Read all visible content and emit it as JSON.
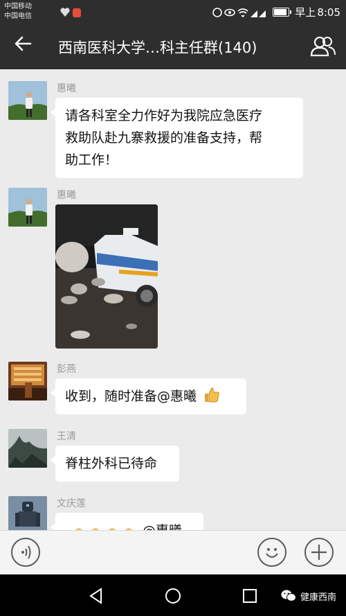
{
  "status_bar": {
    "carrier_1": "中国移动",
    "carrier_2": "中国电信",
    "network_1": "4G",
    "network_2": "3G/2G",
    "battery_level": 0.9,
    "period": "早上",
    "time": "8:05"
  },
  "header": {
    "title": "西南医科大学…科主任群(140)",
    "back_icon": "arrow-left-icon",
    "members_icon": "people-icon"
  },
  "messages": [
    {
      "sender": "惠曦",
      "type": "text",
      "lines": [
        "请各科室全力作好为我院应急医疗",
        "救助队赴九寨救援的准备支持，帮",
        "助工作！"
      ]
    },
    {
      "sender": "惠曦",
      "type": "image",
      "image_desc_icon": "photo-icon"
    },
    {
      "sender": "彭燕",
      "type": "text",
      "text": "收到，随时准备@惠曦",
      "emoji": "thumbs-up-icon"
    },
    {
      "sender": "王清",
      "type": "text",
      "text": "脊柱外科已待命"
    },
    {
      "sender": "文庆莲",
      "type": "text",
      "text": "@惠曦"
    }
  ],
  "input_bar": {
    "voice_icon": "voice-icon",
    "emoji_icon": "smiley-icon",
    "plus_icon": "plus-icon"
  },
  "nav_bar": {
    "back_icon": "nav-back-icon",
    "home_icon": "nav-home-icon",
    "recent_icon": "nav-recent-icon"
  },
  "watermark": {
    "text": "健康西南",
    "icon": "wechat-icon"
  }
}
